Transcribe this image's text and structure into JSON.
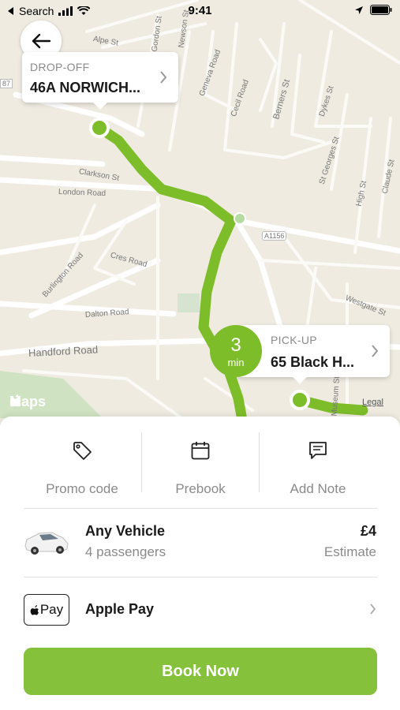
{
  "status_bar": {
    "back_app": "Search",
    "time": "9:41"
  },
  "map": {
    "streets": [
      "Alpe St",
      "Newson St",
      "Gordon St",
      "Geneva Road",
      "Cecil Road",
      "Berners St",
      "Dykes St",
      "St Georges St",
      "High St",
      "Claude St",
      "Clarkson St",
      "London Road",
      "A1156",
      "Burlington Road",
      "Cres Road",
      "Dalton Road",
      "Westgate St",
      "Handford Road",
      "Museum St",
      "87"
    ],
    "attribution": "Maps",
    "legal": "Legal"
  },
  "dropoff": {
    "label": "DROP-OFF",
    "address": "46A NORWICH..."
  },
  "pickup": {
    "label": "PICK-UP",
    "address": "65 Black H..."
  },
  "eta": {
    "value": "3",
    "unit": "min"
  },
  "actions": [
    {
      "label": "Promo code",
      "icon": "tag-icon"
    },
    {
      "label": "Prebook",
      "icon": "calendar-icon"
    },
    {
      "label": "Add Note",
      "icon": "note-icon"
    }
  ],
  "vehicle": {
    "name": "Any Vehicle",
    "passengers": "4 passengers",
    "price": "£4",
    "price_note": "Estimate"
  },
  "payment": {
    "badge": "Pay",
    "method": "Apple Pay"
  },
  "book_button": "Book Now",
  "colors": {
    "accent": "#85c13b",
    "route": "#7dbd2a",
    "map_bg": "#efebe1"
  }
}
